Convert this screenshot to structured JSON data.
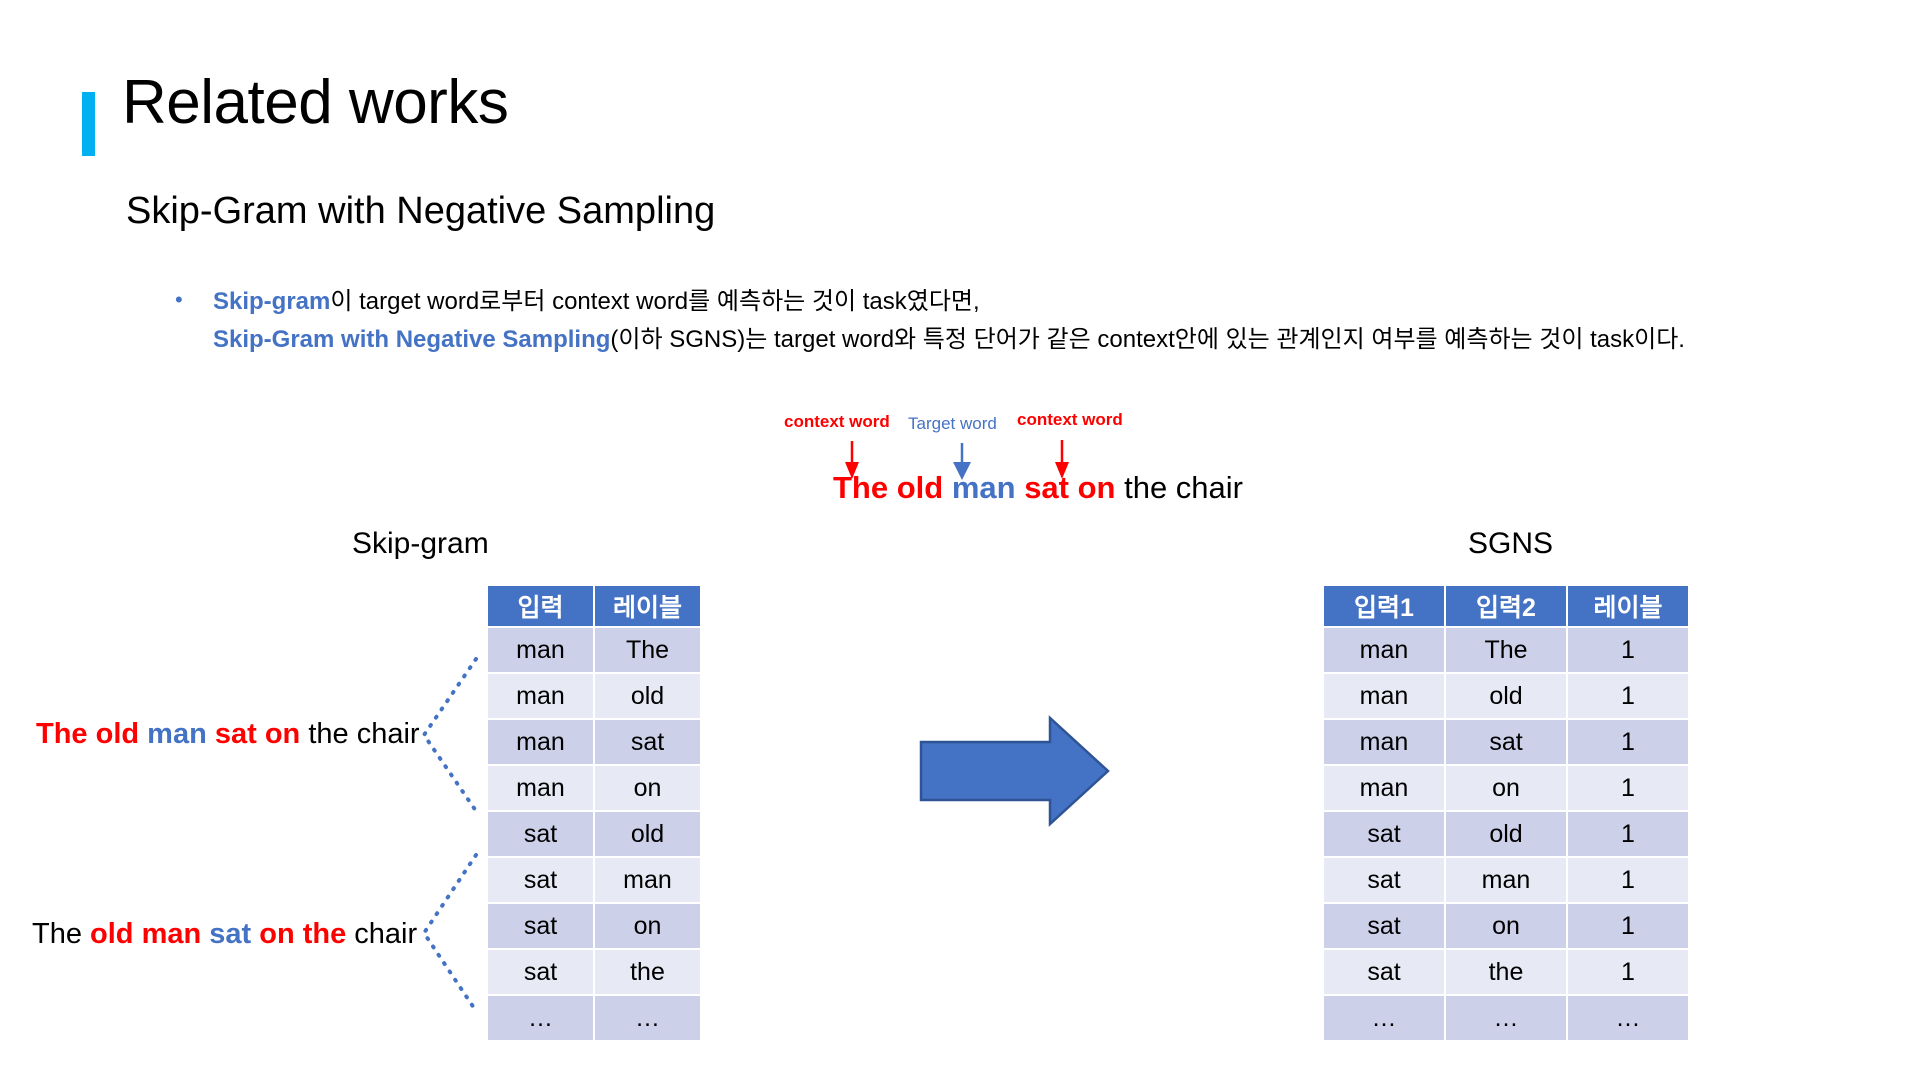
{
  "slide": {
    "title": "Related works",
    "subtitle": "Skip-Gram with Negative Sampling",
    "accent_color": "#00b0f0",
    "header_blue": "#4472c4",
    "red": "#ff0000",
    "row_dark": "#ccd0e8",
    "row_light": "#e7eaf4"
  },
  "bullet": {
    "marker": "•",
    "line1": {
      "highlight": "Skip-gram",
      "rest": "이 target word로부터 context word를 예측하는 것이 task였다면,"
    },
    "line2": {
      "highlight": "Skip-Gram with Negative Sampling",
      "rest": "(이하 SGNS)는 target word와 특정 단어가 같은 context안에 있는 관계인지 여부를 예측하는 것이 task이다."
    }
  },
  "annotation": {
    "label_left": "context word",
    "label_center": "Target word",
    "label_right": "context word",
    "sentence": {
      "seg1": "The old ",
      "seg2": "man ",
      "seg3": "sat on ",
      "seg4": "the chair"
    }
  },
  "captions": {
    "left": "Skip-gram",
    "right": "SGNS"
  },
  "example_sentences": {
    "first": {
      "seg1": "The old ",
      "seg2": "man ",
      "seg3": "sat on ",
      "seg4": "the chair"
    },
    "second": {
      "seg1": "The ",
      "seg2": "old man ",
      "seg3": "sat ",
      "seg4": "on the ",
      "seg5": "chair"
    }
  },
  "skipgram_table": {
    "headers": [
      "입력",
      "레이블"
    ],
    "rows": [
      [
        "man",
        "The"
      ],
      [
        "man",
        "old"
      ],
      [
        "man",
        "sat"
      ],
      [
        "man",
        "on"
      ],
      [
        "sat",
        "old"
      ],
      [
        "sat",
        "man"
      ],
      [
        "sat",
        "on"
      ],
      [
        "sat",
        "the"
      ],
      [
        "…",
        "…"
      ]
    ]
  },
  "sgns_table": {
    "headers": [
      "입력1",
      "입력2",
      "레이블"
    ],
    "rows": [
      [
        "man",
        "The",
        "1"
      ],
      [
        "man",
        "old",
        "1"
      ],
      [
        "man",
        "sat",
        "1"
      ],
      [
        "man",
        "on",
        "1"
      ],
      [
        "sat",
        "old",
        "1"
      ],
      [
        "sat",
        "man",
        "1"
      ],
      [
        "sat",
        "on",
        "1"
      ],
      [
        "sat",
        "the",
        "1"
      ],
      [
        "…",
        "…",
        "…"
      ]
    ]
  }
}
